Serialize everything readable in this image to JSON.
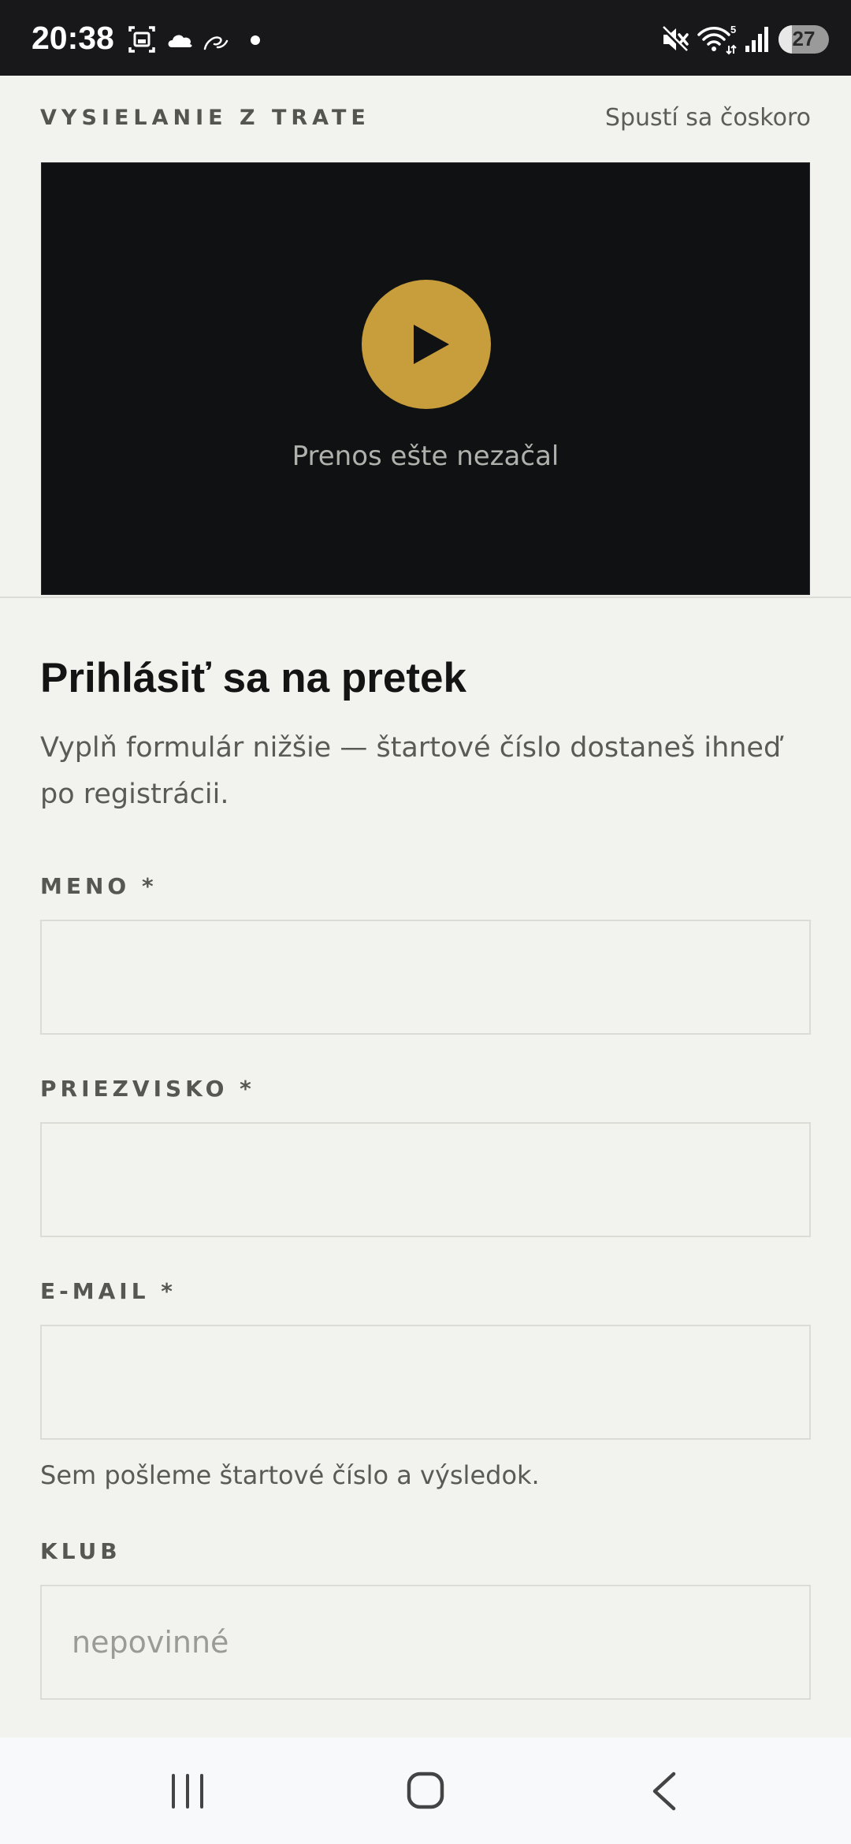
{
  "status_bar": {
    "time": "20:38",
    "icons": [
      "screenshot-icon",
      "cloud-icon",
      "swipe-icon",
      "dot-icon",
      "mute-icon",
      "wifi-icon",
      "signal-icon"
    ],
    "wifi_badge": "5",
    "battery": "27",
    "battery_level": 0.27
  },
  "stream": {
    "label": "VYSIELANIE Z TRATE",
    "status": "Spustí sa čoskoro",
    "message": "Prenos ešte nezačal",
    "accent_color": "#c89d3c"
  },
  "form": {
    "title": "Prihlásiť sa na pretek",
    "description": "Vyplň formulár nižšie — štartové číslo dostaneš ihneď po registrácii.",
    "fields": {
      "first_name": {
        "label": "MENO *",
        "value": "",
        "placeholder": ""
      },
      "last_name": {
        "label": "PRIEZVISKO *",
        "value": "",
        "placeholder": ""
      },
      "email": {
        "label": "E-MAIL *",
        "value": "",
        "placeholder": "",
        "hint": "Sem pošleme štartové číslo a výsledok."
      },
      "club": {
        "label": "KLUB",
        "value": "",
        "placeholder": "nepovinné"
      }
    }
  },
  "nav_bar": {
    "buttons": [
      "recent-apps-icon",
      "home-icon",
      "back-icon"
    ]
  }
}
